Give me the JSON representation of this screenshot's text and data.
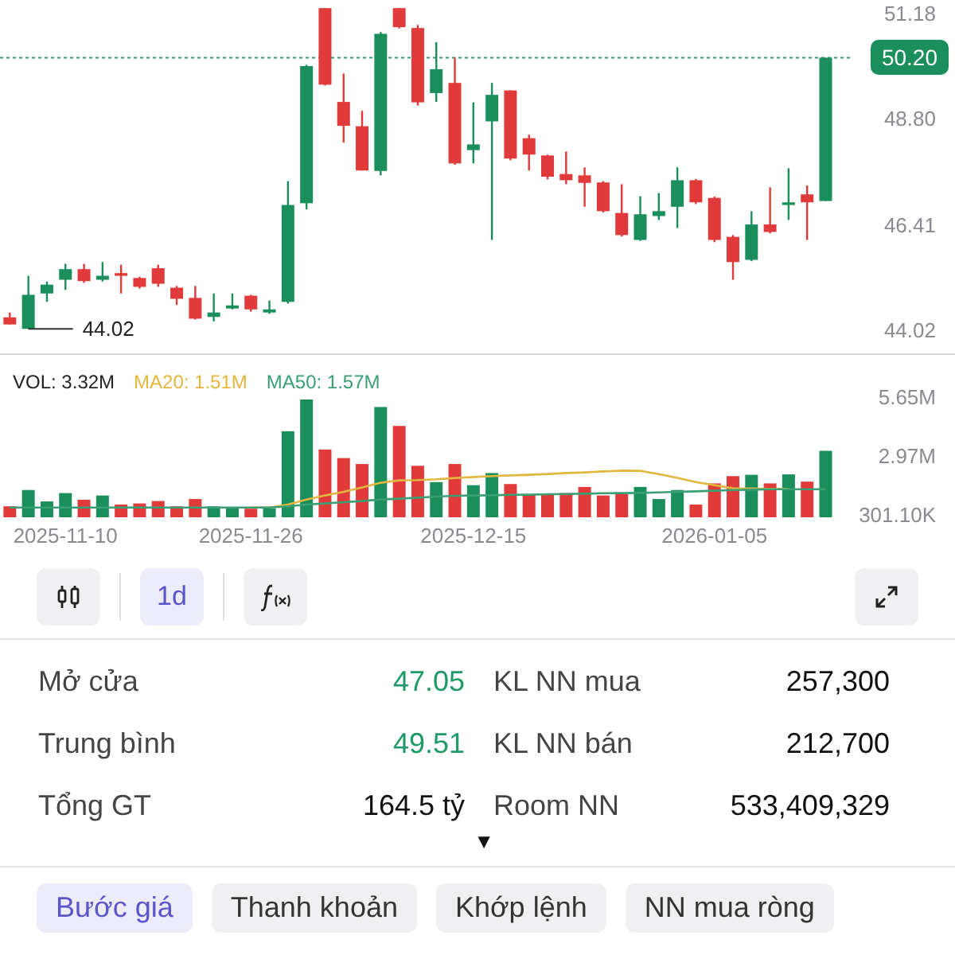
{
  "price_chart": {
    "chart_data": {
      "type": "candlestick",
      "categories": [
        null,
        null,
        null,
        null,
        null,
        null,
        null,
        null,
        null,
        null,
        null,
        null,
        null,
        null,
        null,
        null,
        null,
        null,
        null,
        null,
        null,
        null,
        null,
        null,
        null,
        null,
        null,
        null,
        null,
        null,
        null,
        null,
        null,
        null,
        null,
        null,
        null,
        null,
        null,
        null,
        null,
        null,
        null,
        null,
        null
      ],
      "ohlc": [
        [
          44.33,
          44.44,
          44.17,
          44.17
        ],
        [
          44.07,
          45.27,
          44.07,
          44.84
        ],
        [
          44.87,
          45.14,
          44.68,
          45.07
        ],
        [
          45.18,
          45.54,
          44.95,
          45.42
        ],
        [
          45.42,
          45.54,
          45.11,
          45.15
        ],
        [
          45.18,
          45.58,
          45.14,
          45.27
        ],
        [
          45.33,
          45.52,
          44.87,
          45.27
        ],
        [
          45.22,
          45.25,
          44.98,
          45.02
        ],
        [
          45.44,
          45.52,
          45.02,
          45.09
        ],
        [
          45.0,
          45.04,
          44.61,
          44.75
        ],
        [
          44.77,
          45.04,
          44.28,
          44.3
        ],
        [
          44.34,
          44.87,
          44.24,
          44.44
        ],
        [
          44.53,
          44.87,
          44.51,
          44.6
        ],
        [
          44.82,
          44.84,
          44.46,
          44.51
        ],
        [
          44.44,
          44.71,
          44.41,
          44.51
        ],
        [
          44.68,
          47.41,
          44.64,
          46.87
        ],
        [
          46.91,
          50.04,
          46.77,
          50.01
        ],
        [
          51.32,
          51.32,
          49.57,
          49.59
        ],
        [
          49.2,
          49.84,
          48.28,
          48.66
        ],
        [
          48.65,
          49.0,
          47.65,
          47.65
        ],
        [
          47.64,
          50.78,
          47.54,
          50.74
        ],
        [
          51.32,
          51.32,
          50.86,
          50.89
        ],
        [
          50.87,
          50.94,
          49.12,
          49.19
        ],
        [
          49.4,
          50.55,
          49.2,
          49.94
        ],
        [
          49.63,
          50.2,
          47.78,
          47.81
        ],
        [
          48.11,
          49.19,
          47.81,
          48.24
        ],
        [
          48.76,
          49.63,
          46.08,
          49.36
        ],
        [
          49.46,
          49.46,
          47.88,
          47.92
        ],
        [
          48.38,
          48.46,
          47.65,
          48.01
        ],
        [
          47.99,
          48.01,
          47.45,
          47.51
        ],
        [
          47.57,
          48.08,
          47.34,
          47.43
        ],
        [
          47.54,
          47.72,
          46.83,
          47.37
        ],
        [
          47.38,
          47.41,
          46.7,
          46.73
        ],
        [
          46.69,
          47.34,
          46.16,
          46.19
        ],
        [
          46.08,
          47.07,
          46.06,
          46.66
        ],
        [
          46.62,
          47.14,
          46.53,
          46.73
        ],
        [
          46.83,
          47.72,
          46.35,
          47.43
        ],
        [
          47.43,
          47.46,
          46.89,
          46.93
        ],
        [
          47.03,
          47.06,
          46.03,
          46.08
        ],
        [
          46.15,
          46.19,
          45.18,
          45.58
        ],
        [
          45.63,
          46.73,
          45.6,
          46.43
        ],
        [
          46.43,
          47.27,
          46.23,
          46.26
        ],
        [
          46.87,
          47.7,
          46.53,
          46.93
        ],
        [
          47.11,
          47.31,
          46.08,
          46.93
        ],
        [
          46.96,
          50.2,
          46.96,
          50.2
        ]
      ],
      "ylim": [
        44.02,
        51.18
      ],
      "yticks": [
        {
          "value": 51.18,
          "label": "51.18"
        },
        {
          "value": 48.8,
          "label": "48.80"
        },
        {
          "value": 46.41,
          "label": "46.41"
        },
        {
          "value": 44.02,
          "label": "44.02"
        }
      ],
      "ref_lines": [
        {
          "axis": "y",
          "value": 50.2,
          "label": "50.20"
        }
      ],
      "annotations": [
        "44.02"
      ]
    }
  },
  "volume_chart": {
    "legend": [
      {
        "label": "VOL: 3.32M",
        "color": "#222222"
      },
      {
        "label": "MA20: 1.51M",
        "color": "#e2b740"
      },
      {
        "label": "MA50: 1.57M",
        "color": "#3a9f72"
      }
    ],
    "chart_data": {
      "type": "bar",
      "categories": [
        null,
        null,
        null,
        "2025-11-10",
        null,
        null,
        null,
        null,
        null,
        null,
        null,
        null,
        null,
        "2025-11-26",
        null,
        null,
        null,
        null,
        null,
        null,
        null,
        null,
        null,
        null,
        null,
        "2025-12-15",
        null,
        null,
        null,
        null,
        null,
        null,
        null,
        null,
        null,
        null,
        null,
        null,
        "2026-01-05",
        null,
        null,
        null,
        null,
        null,
        null
      ],
      "series": [
        {
          "type": "bar",
          "colors": [
            "#e03a3a",
            "#1a8f5c",
            "#1a8f5c",
            "#1a8f5c",
            "#e03a3a",
            "#1a8f5c",
            "#e03a3a",
            "#e03a3a",
            "#e03a3a",
            "#e03a3a",
            "#e03a3a",
            "#1a8f5c",
            "#1a8f5c",
            "#e03a3a",
            "#1a8f5c",
            "#1a8f5c",
            "#1a8f5c",
            "#e03a3a",
            "#e03a3a",
            "#e03a3a",
            "#1a8f5c",
            "#e03a3a",
            "#e03a3a",
            "#1a8f5c",
            "#e03a3a",
            "#1a8f5c",
            "#1a8f5c",
            "#e03a3a",
            "#e03a3a",
            "#e03a3a",
            "#e03a3a",
            "#e03a3a",
            "#e03a3a",
            "#e03a3a",
            "#1a8f5c",
            "#1a8f5c",
            "#1a8f5c",
            "#e03a3a",
            "#e03a3a",
            "#e03a3a",
            "#1a8f5c",
            "#e03a3a",
            "#1a8f5c",
            "#e03a3a",
            "#1a8f5c"
          ],
          "values": [
            800000,
            1540000,
            1020000,
            1400000,
            1100000,
            1290000,
            880000,
            930000,
            1040000,
            800000,
            1130000,
            800000,
            740000,
            690000,
            710000,
            4210000,
            5650000,
            3380000,
            2990000,
            2720000,
            5310000,
            4450000,
            2640000,
            1900000,
            2720000,
            1760000,
            2310000,
            1810000,
            1350000,
            1350000,
            1400000,
            1680000,
            1290000,
            1350000,
            1680000,
            1130000,
            1540000,
            880000,
            1840000,
            2170000,
            2230000,
            1840000,
            2250000,
            1920000,
            3320000
          ]
        },
        {
          "type": "line",
          "values": [
            null,
            null,
            null,
            null,
            null,
            null,
            null,
            null,
            null,
            null,
            null,
            null,
            null,
            740000,
            740000,
            880000,
            1100000,
            1290000,
            1460000,
            1650000,
            1870000,
            1980000,
            1990000,
            2030000,
            2090000,
            2130000,
            2170000,
            2200000,
            2230000,
            2270000,
            2310000,
            2340000,
            2380000,
            2420000,
            2410000,
            2260000,
            2090000,
            1900000,
            1760000,
            1620000,
            1610000,
            1590000,
            1590000,
            null,
            null
          ]
        },
        {
          "type": "line",
          "values": [
            740000,
            740000,
            740000,
            740000,
            740000,
            740000,
            740000,
            740000,
            740000,
            740000,
            740000,
            740000,
            740000,
            740000,
            740000,
            800000,
            880000,
            930000,
            990000,
            1040000,
            1110000,
            1150000,
            1190000,
            1240000,
            1280000,
            1290000,
            1300000,
            1320000,
            1330000,
            1350000,
            1360000,
            1370000,
            1390000,
            1400000,
            1410000,
            1430000,
            1460000,
            1480000,
            1510000,
            1540000,
            1550000,
            1570000,
            1570000,
            1570000,
            1570000
          ]
        }
      ],
      "ylim": [
        301100,
        5650000
      ],
      "yticks": [
        {
          "value": 5650000,
          "label": "5.65M"
        },
        {
          "value": 2970000,
          "label": "2.97M"
        },
        {
          "value": 301100,
          "label": "301.10K"
        }
      ]
    }
  },
  "toolbar": [
    {
      "kind": "chart-type",
      "selected": false
    },
    {
      "kind": "interval",
      "label": "1d",
      "selected": true
    },
    {
      "kind": "indicator",
      "selected": false
    }
  ],
  "stats": [
    {
      "label": "Mở cửa",
      "value": "47.05",
      "color": "#1f9a66"
    },
    {
      "label": "KL NN mua",
      "value": "257,300",
      "color": "#111111"
    },
    {
      "label": "Trung bình",
      "value": "49.51",
      "color": "#1f9a66"
    },
    {
      "label": "KL NN bán",
      "value": "212,700",
      "color": "#111111"
    },
    {
      "label": "Tổng GT",
      "value": "164.5 tỷ",
      "color": "#111111"
    },
    {
      "label": "Room NN",
      "value": "533,409,329",
      "color": "#111111"
    }
  ],
  "expand_toggle": "▼",
  "tabs": [
    {
      "label": "Bước giá",
      "selected": true
    },
    {
      "label": "Thanh khoản",
      "selected": false
    },
    {
      "label": "Khớp lệnh",
      "selected": false
    },
    {
      "label": "NN mua ròng",
      "selected": false
    }
  ]
}
